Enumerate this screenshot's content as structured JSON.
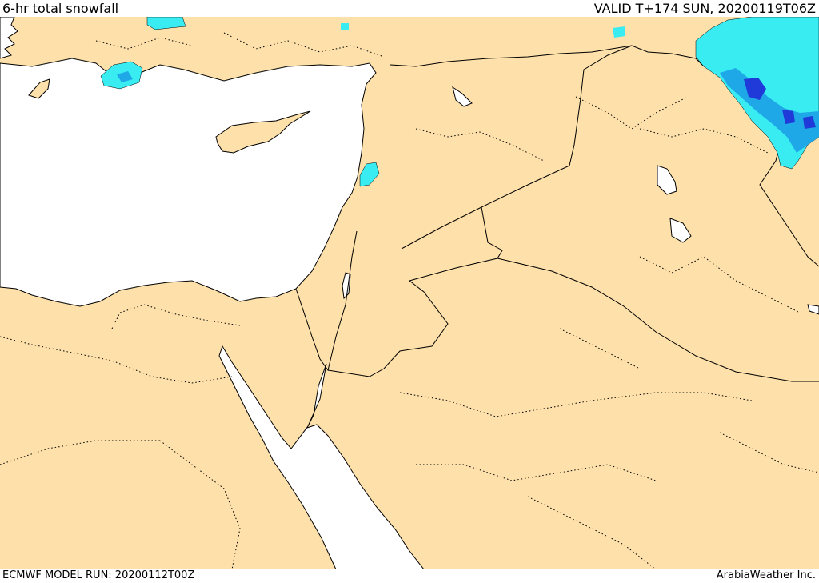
{
  "header": {
    "title": "6-hr total snowfall",
    "valid": "VALID T+174 SUN, 20200119T06Z"
  },
  "footer": {
    "model_run": "ECMWF MODEL RUN: 20200112T00Z",
    "brand": "ArabiaWeather Inc."
  },
  "map": {
    "colors": {
      "land": "#fde0aa",
      "water": "#ffffff",
      "snow_light": "#38ecf2",
      "snow_medium": "#1fa8e8",
      "snow_heavy": "#1f3ad9"
    }
  }
}
